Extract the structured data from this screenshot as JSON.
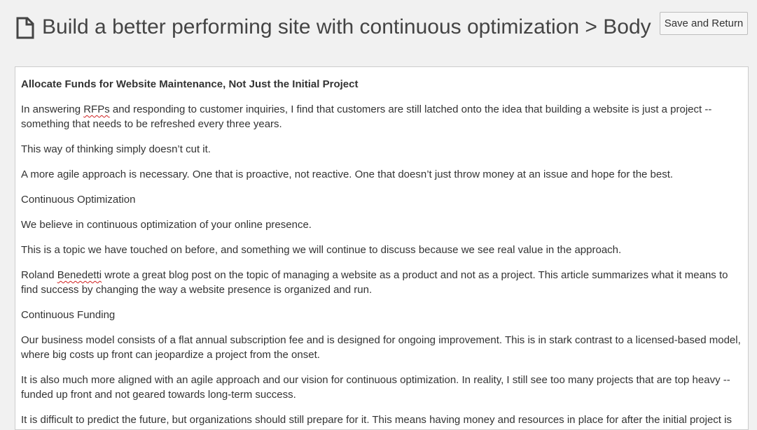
{
  "header": {
    "title": "Build a better performing site with continuous optimization > Body",
    "icon": "document-icon",
    "save_label": "Save and Return"
  },
  "editor": {
    "heading": "Allocate Funds for Website Maintenance, Not Just the Initial Project",
    "p1": {
      "before": "In answering ",
      "misspelled": "RFPs",
      "after": " and responding to customer inquiries, I find that customers are still latched onto the idea that building a website is just a project -- something that needs to be refreshed every three years."
    },
    "p2": "This way of thinking simply doesn’t cut it.",
    "p3": "A more agile approach is necessary. One that is proactive, not reactive. One that doesn’t just throw money at an issue and hope for the best.",
    "p4": "Continuous Optimization",
    "p5": "We believe in continuous optimization of your online presence.",
    "p6": "This is a topic we have touched on before, and something we will continue to discuss because we see real value in the approach.",
    "p7": {
      "before": "Roland ",
      "misspelled": "Benedetti",
      "after": " wrote a great blog post on the topic of managing a website as a product and not as a project. This article summarizes what it means to find success by changing the way a website presence is organized and run."
    },
    "p8": "Continuous Funding",
    "p9": "Our business model consists of a flat annual subscription fee and is designed for ongoing improvement. This is in stark contrast to a licensed-based model, where big costs up front can jeopardize a project from the onset.",
    "p10": "It is also much more aligned with an agile approach and our vision for continuous optimization. In reality, I still see too many projects that are top heavy -- funded up front and not geared towards long-term success.",
    "p11": "It is difficult to predict the future, but organizations should still prepare for it. This means having money and resources in place for after the initial project is"
  },
  "colors": {
    "background": "#f1f1f1",
    "editor_background": "#ffffff",
    "text": "#333333",
    "title": "#444444",
    "spellcheck": "#d02020"
  }
}
